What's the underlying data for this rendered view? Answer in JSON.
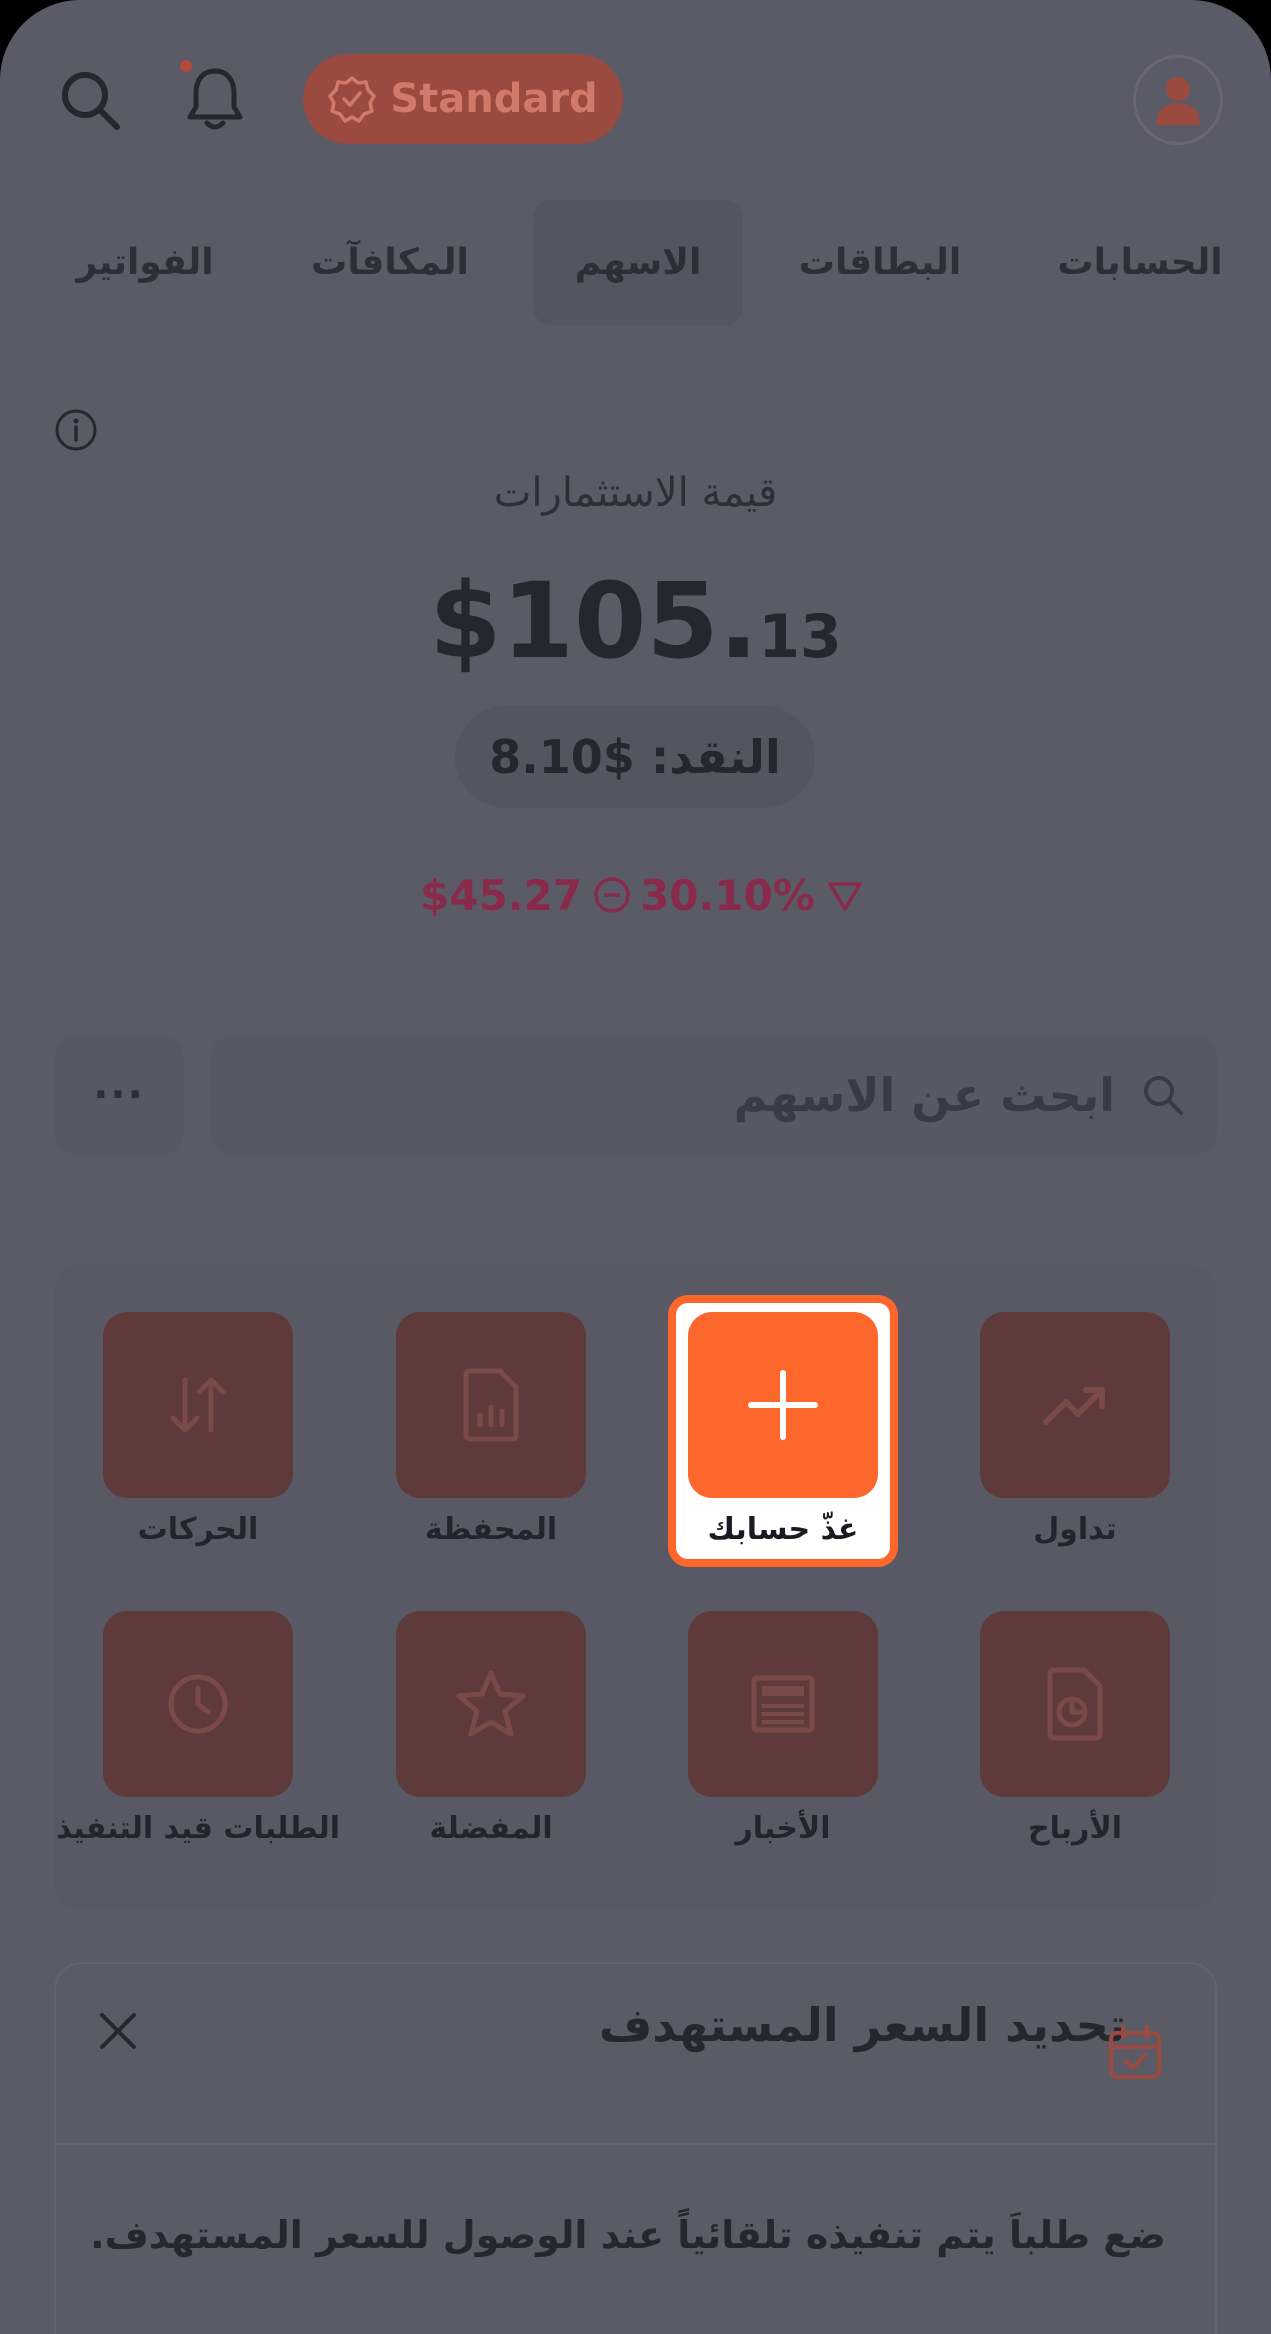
{
  "header": {
    "plan_label": "Standard"
  },
  "tabs": [
    {
      "label": "الحسابات"
    },
    {
      "label": "البطاقات"
    },
    {
      "label": "الاسهم"
    },
    {
      "label": "المكافآت"
    },
    {
      "label": "الفواتير"
    }
  ],
  "portfolio": {
    "label": "قيمة الاستثمارات",
    "value_whole": "$105.",
    "value_cents": "13",
    "cash_label": "النقد: $8.10",
    "change_percent": "30.10%",
    "change_amount": "$45.27"
  },
  "search": {
    "placeholder": "ابحث عن الاسهم",
    "more_label": "···"
  },
  "actions": [
    {
      "label": "تداول",
      "icon": "trending-up-icon"
    },
    {
      "label": "غذّ حسابك",
      "icon": "plus-icon",
      "highlighted": true
    },
    {
      "label": "المحفظة",
      "icon": "report-file-icon"
    },
    {
      "label": "الحركات",
      "icon": "swap-vertical-icon"
    },
    {
      "label": "الأرباح",
      "icon": "dividend-file-icon"
    },
    {
      "label": "الأخبار",
      "icon": "newspaper-icon"
    },
    {
      "label": "المفضلة",
      "icon": "star-icon"
    },
    {
      "label": "الطلبات قيد التنفيذ",
      "icon": "clock-icon"
    }
  ],
  "target_price": {
    "title": "تحديد السعر المستهدف",
    "description": "ضع طلباَ يتم تنفيذه تلقائياً عند الوصول للسعر المستهدف."
  },
  "colors": {
    "accent": "#fd672c",
    "tile": "#5f3a3a",
    "negative": "#8a2a4a",
    "background": "#5b5b68"
  }
}
